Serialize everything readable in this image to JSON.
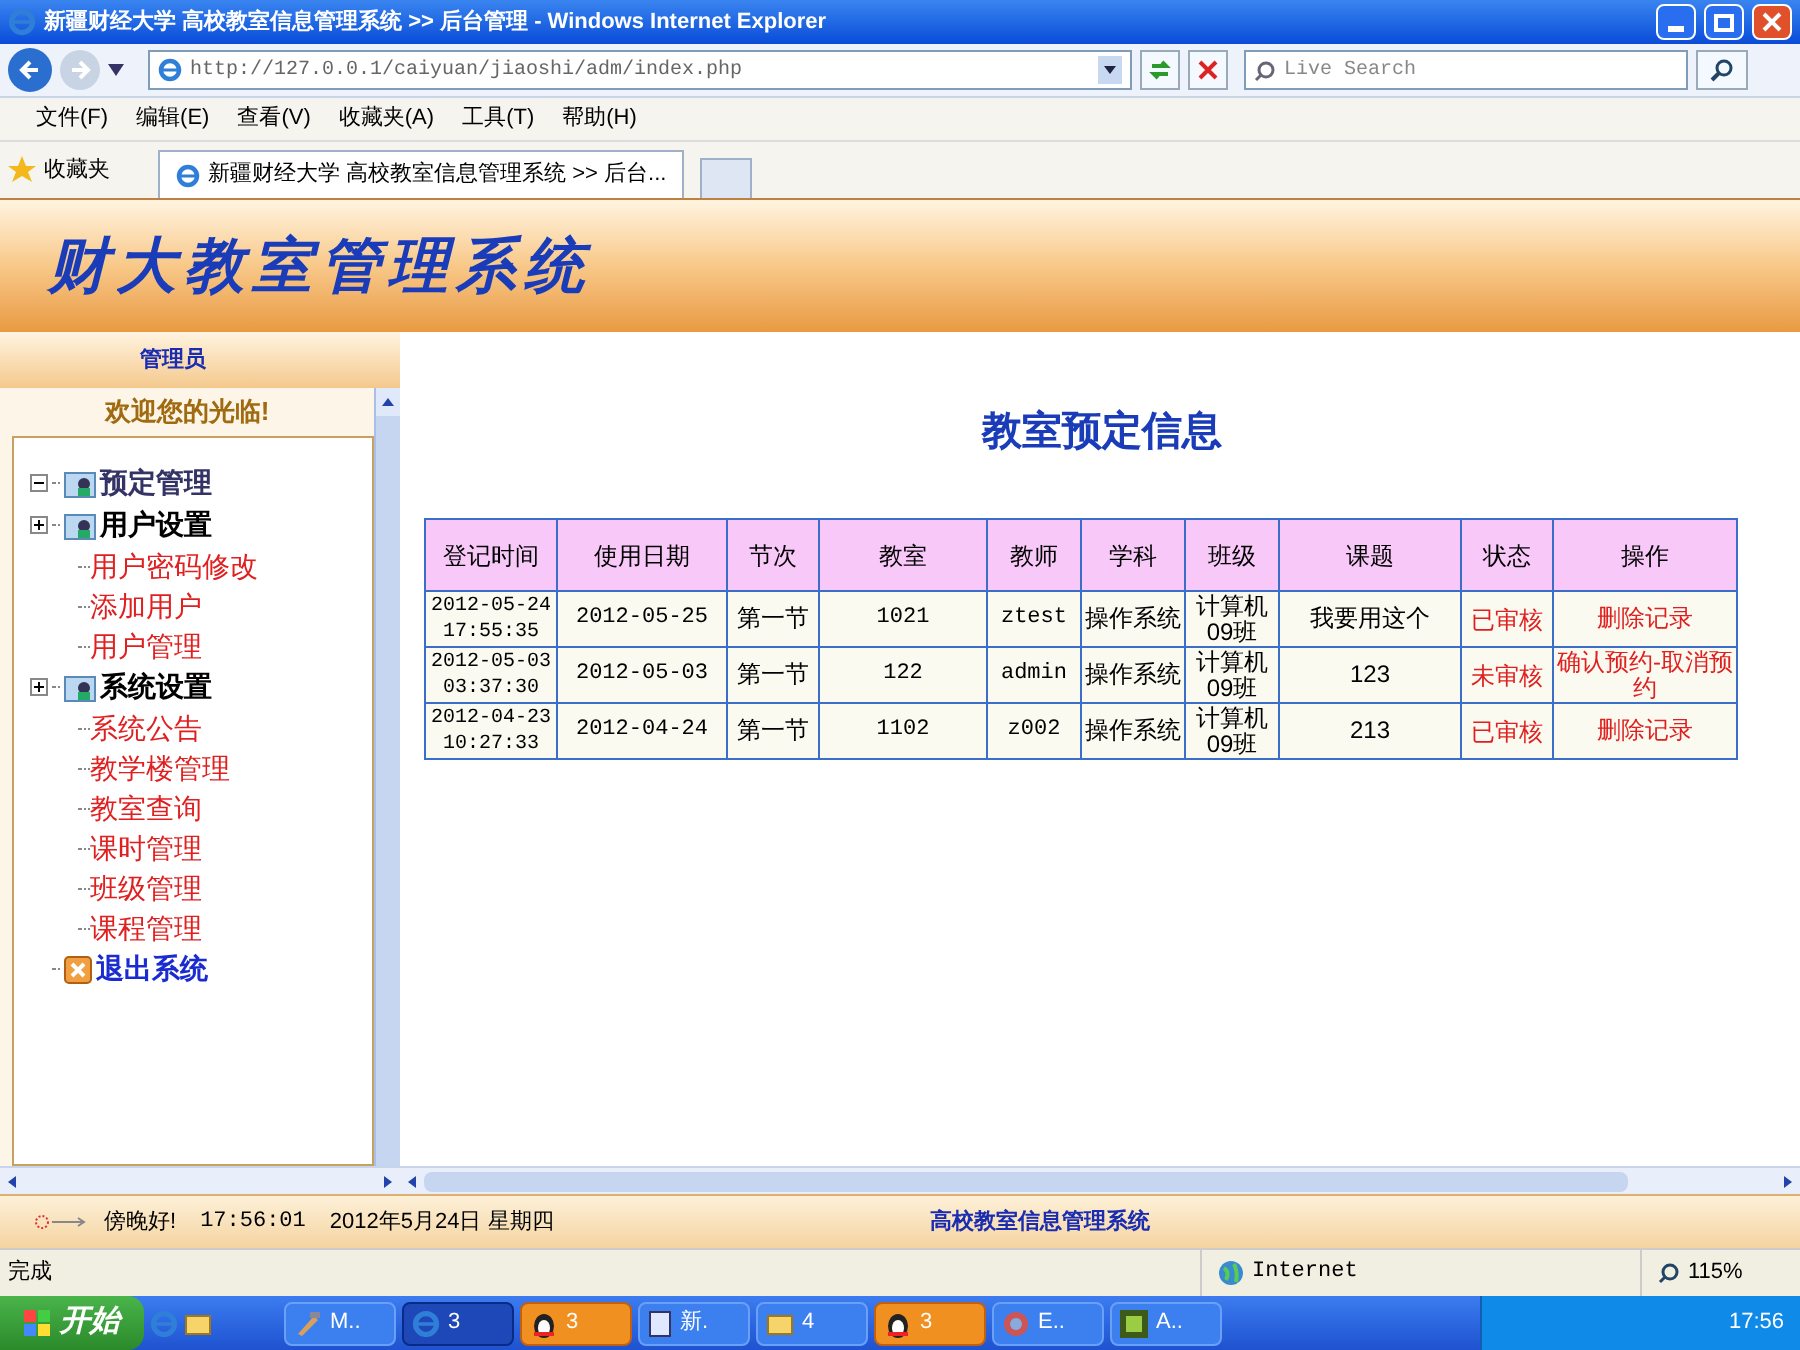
{
  "window": {
    "title": "新疆财经大学 高校教室信息管理系统 >> 后台管理 - Windows Internet Explorer"
  },
  "address": {
    "url": "http://127.0.0.1/caiyuan/jiaoshi/adm/index.php",
    "search_placeholder": "Live Search"
  },
  "menu": [
    "文件(F)",
    "编辑(E)",
    "查看(V)",
    "收藏夹(A)",
    "工具(T)",
    "帮助(H)"
  ],
  "favorites": {
    "label": "收藏夹",
    "tabs": [
      {
        "label": "新疆财经大学 高校教室信息管理系统 >> 后台...",
        "selected": true
      }
    ]
  },
  "banner": {
    "title": "财大教室管理系统"
  },
  "sidebar": {
    "role": "管理员",
    "welcome": "欢迎您的光临!",
    "tree": [
      {
        "label": "预定管理",
        "kind": "folder",
        "expanded": true
      },
      {
        "label": "用户设置",
        "kind": "folder",
        "expanded": false,
        "children": [
          {
            "label": "用户密码修改"
          },
          {
            "label": "添加用户"
          },
          {
            "label": "用户管理"
          }
        ]
      },
      {
        "label": "系统设置",
        "kind": "folder",
        "expanded": false,
        "children": [
          {
            "label": "系统公告"
          },
          {
            "label": "教学楼管理"
          },
          {
            "label": "教室查询"
          },
          {
            "label": "课时管理"
          },
          {
            "label": "班级管理"
          },
          {
            "label": "课程管理"
          }
        ]
      },
      {
        "label": "退出系统",
        "kind": "exit"
      }
    ]
  },
  "content": {
    "title": "教室预定信息",
    "table": {
      "columns": [
        "登记时间",
        "使用日期",
        "节次",
        "教室",
        "教师",
        "学科",
        "班级",
        "课题",
        "状态",
        "操作"
      ],
      "rows": [
        {
          "cells": [
            "2012-05-24 17:55:35",
            "2012-05-25",
            "第一节",
            "1021",
            "ztest",
            "操作系统",
            "计算机09班",
            "我要用这个"
          ],
          "status": "已审核",
          "actions": [
            "删除记录"
          ]
        },
        {
          "cells": [
            "2012-05-03 03:37:30",
            "2012-05-03",
            "第一节",
            "122",
            "admin",
            "操作系统",
            "计算机09班",
            "123"
          ],
          "status": "未审核",
          "actions": [
            "确认预约-取消预约"
          ]
        },
        {
          "cells": [
            "2012-04-23 10:27:33",
            "2012-04-24",
            "第一节",
            "1102",
            "z002",
            "操作系统",
            "计算机09班",
            "213"
          ],
          "status": "已审核",
          "actions": [
            "删除记录"
          ]
        }
      ]
    }
  },
  "footer": {
    "greeting": "傍晚好!",
    "time": "17:56:01",
    "date": "2012年5月24日 星期四",
    "system_name": "高校教室信息管理系统"
  },
  "status_bar": {
    "status": "完成",
    "zone": "Internet",
    "zoom": "115%"
  },
  "taskbar": {
    "start": "开始",
    "tasks": [
      {
        "label": "M..",
        "kind": "tool",
        "selected": false
      },
      {
        "label": "3",
        "kind": "ie",
        "selected": true
      },
      {
        "label": "3",
        "kind": "qq",
        "selected": false
      },
      {
        "label": "新.",
        "kind": "doc",
        "selected": false
      },
      {
        "label": "4",
        "kind": "folder",
        "selected": false
      },
      {
        "label": "3",
        "kind": "qq",
        "selected": false
      },
      {
        "label": "E..",
        "kind": "app",
        "selected": false
      },
      {
        "label": "A..",
        "kind": "dw",
        "selected": false
      }
    ],
    "clock": "17:56"
  }
}
